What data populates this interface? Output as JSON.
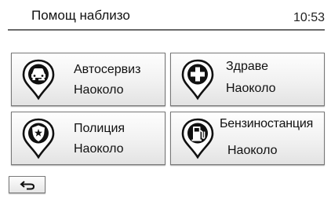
{
  "header": {
    "title": "Помощ наблизо",
    "time": "10:53"
  },
  "tiles": [
    {
      "label": "Автосервиз",
      "sublabel": "Наоколо",
      "icon": "car-repair-icon"
    },
    {
      "label": "Здраве",
      "sublabel": "Наоколо",
      "icon": "medical-cross-icon"
    },
    {
      "label": "Полиция",
      "sublabel": "Наоколо",
      "icon": "police-badge-icon"
    },
    {
      "label": "Бензиностанция",
      "sublabel": "Наоколо",
      "icon": "fuel-pump-icon"
    }
  ],
  "footer": {
    "back_icon": "back-arrow-icon"
  }
}
